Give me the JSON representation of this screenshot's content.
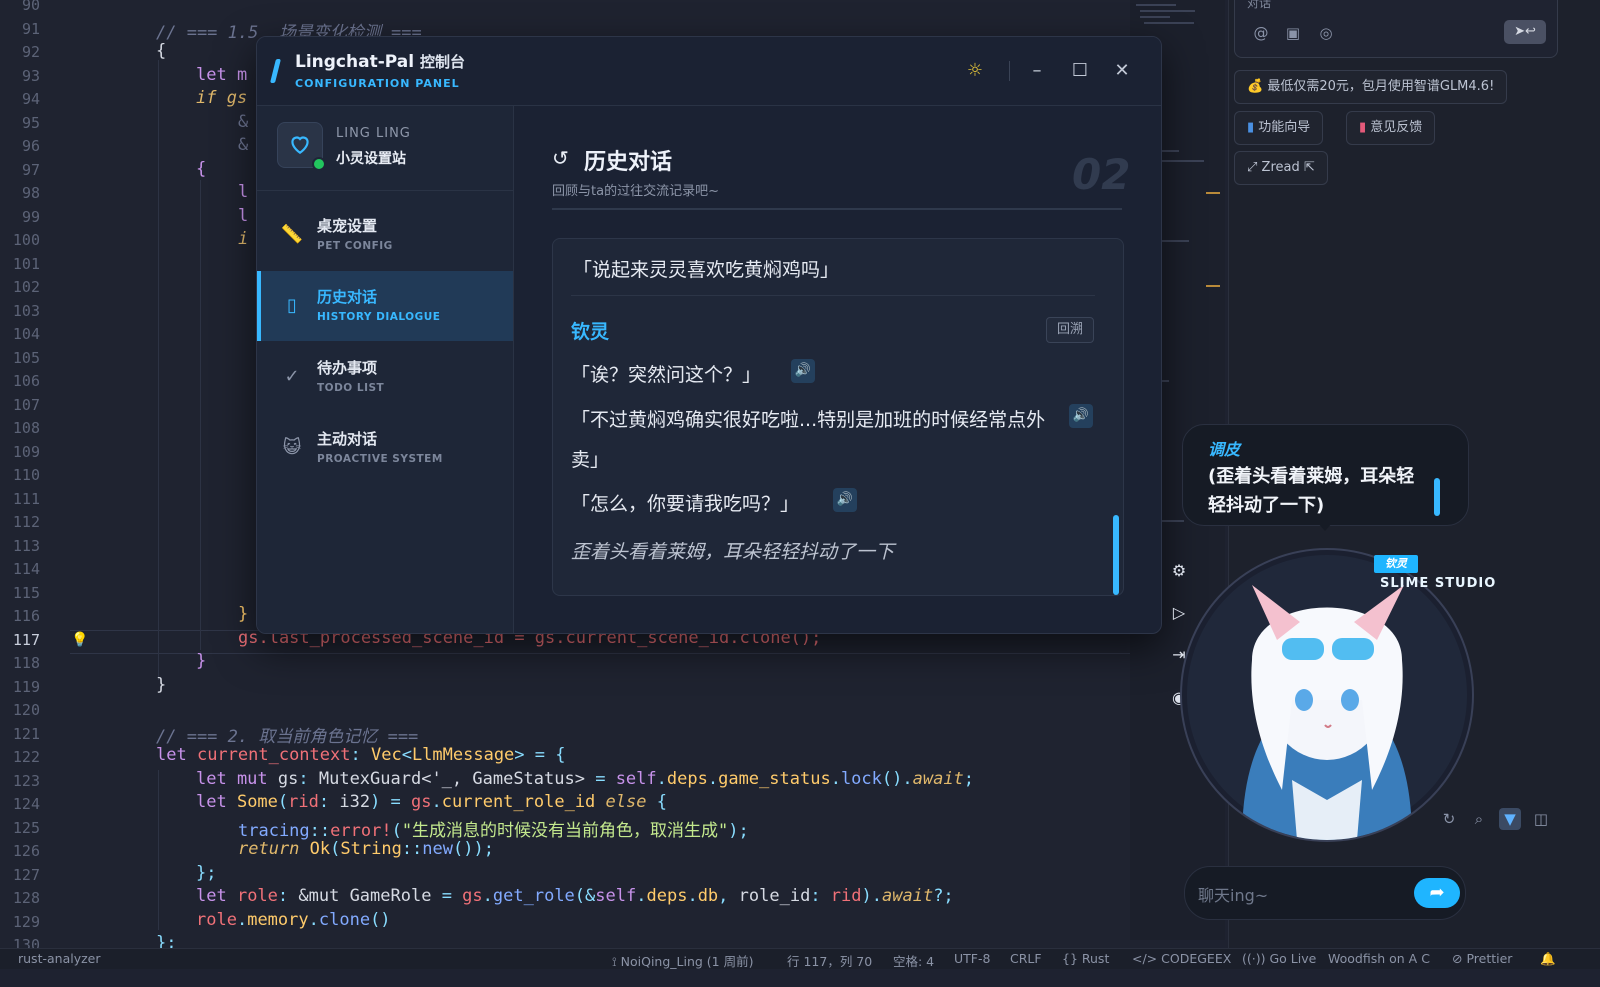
{
  "editor": {
    "line_numbers": [
      "90",
      "91",
      "92",
      "93",
      "94",
      "95",
      "96",
      "97",
      "98",
      "99",
      "100",
      "101",
      "102",
      "103",
      "104",
      "105",
      "106",
      "107",
      "108",
      "109",
      "110",
      "111",
      "112",
      "113",
      "114",
      "115",
      "116",
      "117",
      "118",
      "119",
      "120",
      "121",
      "122",
      "123",
      "124",
      "125",
      "126",
      "127",
      "128",
      "129",
      "130"
    ],
    "active_line": "117",
    "visible_fragments": {
      "l91": "// === 1.5  场景变化检测 ===",
      "l92": "{",
      "l93": "let m",
      "l94": "if gs",
      "l95": "&",
      "l96": "&",
      "l97": "{",
      "l98": "l",
      "l99": "l",
      "l100": "i",
      "l116": "}",
      "l117": "gs.last_processed_scene_id = gs.current_scene_id.clone();",
      "l118": "}",
      "l119": "}",
      "l121": "// === 2. 取当前角色记忆 ===",
      "l122": "let current_context: Vec<LlmMessage> = {",
      "l123": "let mut gs: MutexGuard<'_, GameStatus> = self.deps.game_status.lock().await;",
      "l124": "let Some(rid: i32) = gs.current_role_id else {",
      "l125": "tracing::error!(\"生成消息的时候没有当前角色，取消生成\");",
      "l126": "return Ok(String::new());",
      "l127": "};",
      "l128": "let role: &mut GameRole = gs.get_role(&self.deps.db, role_id: rid).await?;",
      "l129": "role.memory.clone()",
      "l130": "};"
    }
  },
  "right_panel": {
    "input_title": "对话",
    "promo_chip": "最低仅需20元，包月使用智谱GLM4.6!",
    "guide_chip": "功能向导",
    "feedback_chip": "意见反馈",
    "zread_chip": "Zread",
    "icons": [
      "at-icon",
      "folder-code-icon",
      "globe-icon",
      "send-icon"
    ]
  },
  "config_window": {
    "app_name": "Lingchat-Pal",
    "app_name_suffix": "控制台",
    "app_subtitle": "CONFIGURATION PANEL",
    "profile": {
      "name_en": "LING LING",
      "title": "小灵设置站"
    },
    "nav": [
      {
        "label": "桌宠设置",
        "en": "PET CONFIG",
        "icon": "ruler-icon"
      },
      {
        "label": "历史对话",
        "en": "HISTORY DIALOGUE",
        "icon": "book-icon",
        "active": true
      },
      {
        "label": "待办事项",
        "en": "TODO LIST",
        "icon": "check-circle-icon"
      },
      {
        "label": "主动对话",
        "en": "PROACTIVE SYSTEM",
        "icon": "cat-face-icon"
      }
    ],
    "content": {
      "title": "历史对话",
      "subtitle": "回顾与ta的过往交流记录吧~",
      "section_number": "02",
      "card": {
        "question": "「说起来灵灵喜欢吃黄焖鸡吗」",
        "speaker": "钦灵",
        "recall_button": "回溯",
        "lines": [
          "「诶？突然问这个？」",
          "「不过黄焖鸡确实很好吃啦...特别是加班的时候经常点外卖」",
          "「怎么，你要请我吃吗？」"
        ],
        "action": "歪着头看着莱姆，耳朵轻轻抖动了一下"
      }
    }
  },
  "pet_widget": {
    "bubble_name": "调皮",
    "bubble_text": "(歪着头看着莱姆，耳朵轻轻抖动了一下)",
    "name_tag": "钦灵",
    "studio_label": "SLIME STUDIO",
    "chat_placeholder": "聊天ing~",
    "tools": [
      "gear-icon",
      "play-icon",
      "exit-icon",
      "camera-icon"
    ]
  },
  "status_bar": {
    "left": "rust-analyzer",
    "git": "NoiQing_Ling (1 周前)",
    "position": "行 117，列 70",
    "spaces": "空格: 4",
    "encoding": "UTF-8",
    "eol": "CRLF",
    "language": "Rust",
    "codegeex": "CODEGEEX",
    "golive": "Go Live",
    "woodfish": "Woodfish on A C",
    "prettier": "Prettier"
  },
  "colors": {
    "accent": "#38b8ff",
    "window_bg": "#1b2233",
    "editor_bg": "#1f2330"
  }
}
